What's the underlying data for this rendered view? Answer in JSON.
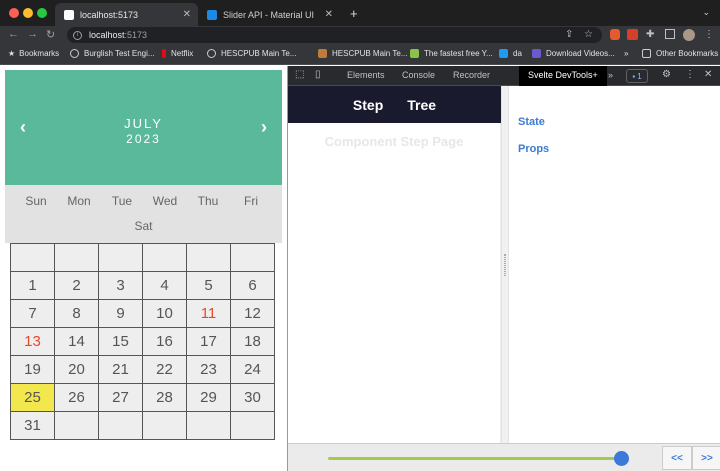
{
  "browser": {
    "tabs": [
      {
        "title": "localhost:5173",
        "active": true
      },
      {
        "title": "Slider API - Material UI",
        "active": false
      }
    ],
    "url_host": "localhost",
    "url_port": ":5173",
    "new_tab": "+",
    "bookmarks": [
      {
        "label": "Bookmarks",
        "icon": "star-icon"
      },
      {
        "label": "Burglish Test Engi...",
        "icon": "globe-icon"
      },
      {
        "label": "Netflix",
        "icon": "netflix-icon"
      },
      {
        "label": "HESCPUB Main Te...",
        "icon": "globe-icon"
      },
      {
        "label": "HESCPUB Main Te...",
        "icon": "bird-icon"
      },
      {
        "label": "The fastest free Y...",
        "icon": "download-icon"
      },
      {
        "label": "da",
        "icon": "twitter-icon"
      },
      {
        "label": "Download Videos...",
        "icon": "video-icon"
      }
    ],
    "bookmarks_overflow": "»",
    "other_bookmarks": "Other Bookmarks"
  },
  "calendar": {
    "month": "JULY",
    "year": "2023",
    "prev": "‹",
    "next": "›",
    "weekdays": [
      "Sun",
      "Mon",
      "Tue",
      "Wed",
      "Thu",
      "Fri",
      "Sat"
    ],
    "days": [
      "",
      "",
      "",
      "",
      "",
      "",
      "1",
      "2",
      "3",
      "4",
      "5",
      "6",
      "7",
      "8",
      "9",
      "10",
      "11",
      "12",
      "13",
      "14",
      "15",
      "16",
      "17",
      "18",
      "19",
      "20",
      "21",
      "22",
      "23",
      "24",
      "25",
      "26",
      "27",
      "28",
      "29",
      "30",
      "31",
      "",
      "",
      "",
      "",
      ""
    ],
    "red_days": [
      "11",
      "13"
    ],
    "today": "25"
  },
  "devtools": {
    "tabs": [
      "Elements",
      "Console",
      "Recorder",
      "Svelte DevTools+"
    ],
    "more": "»",
    "badge": "1",
    "step_tabs": [
      "Step",
      "Tree"
    ],
    "step_title": "Component Step Page",
    "inspector": [
      "State",
      "Props"
    ],
    "prev_button": "<<",
    "next_button": ">>",
    "slider_value": 1.0
  },
  "colors": {
    "calendar_header": "#59b99a",
    "today": "#f2e84d",
    "link": "#3c7bd1",
    "slider_track": "#a5c94d",
    "slider_thumb": "#3b7ad9"
  }
}
